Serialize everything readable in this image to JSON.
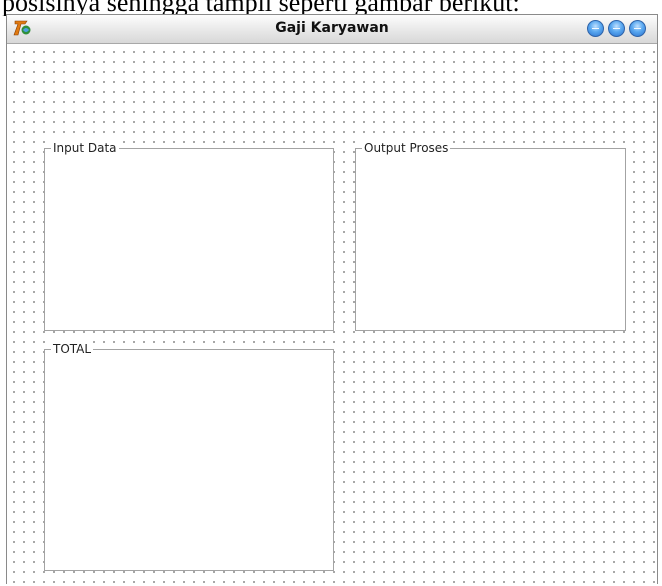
{
  "background_document": {
    "text": "posisinya sehingga tampil seperti gambar berikut:"
  },
  "window": {
    "title": "Gaji Karyawan",
    "icon": "app-logo-icon",
    "controls": [
      {
        "name": "minimize-button",
        "icon": "circle-button-icon",
        "color": "#4a9be8"
      },
      {
        "name": "maximize-button",
        "icon": "circle-button-icon",
        "color": "#4a9be8"
      },
      {
        "name": "close-button",
        "icon": "circle-button-icon",
        "color": "#4a9be8"
      }
    ]
  },
  "form": {
    "grid": "dotted",
    "groups": {
      "input": {
        "title": "Input Data"
      },
      "output": {
        "title": "Output Proses"
      },
      "total": {
        "title": "TOTAL"
      }
    }
  }
}
